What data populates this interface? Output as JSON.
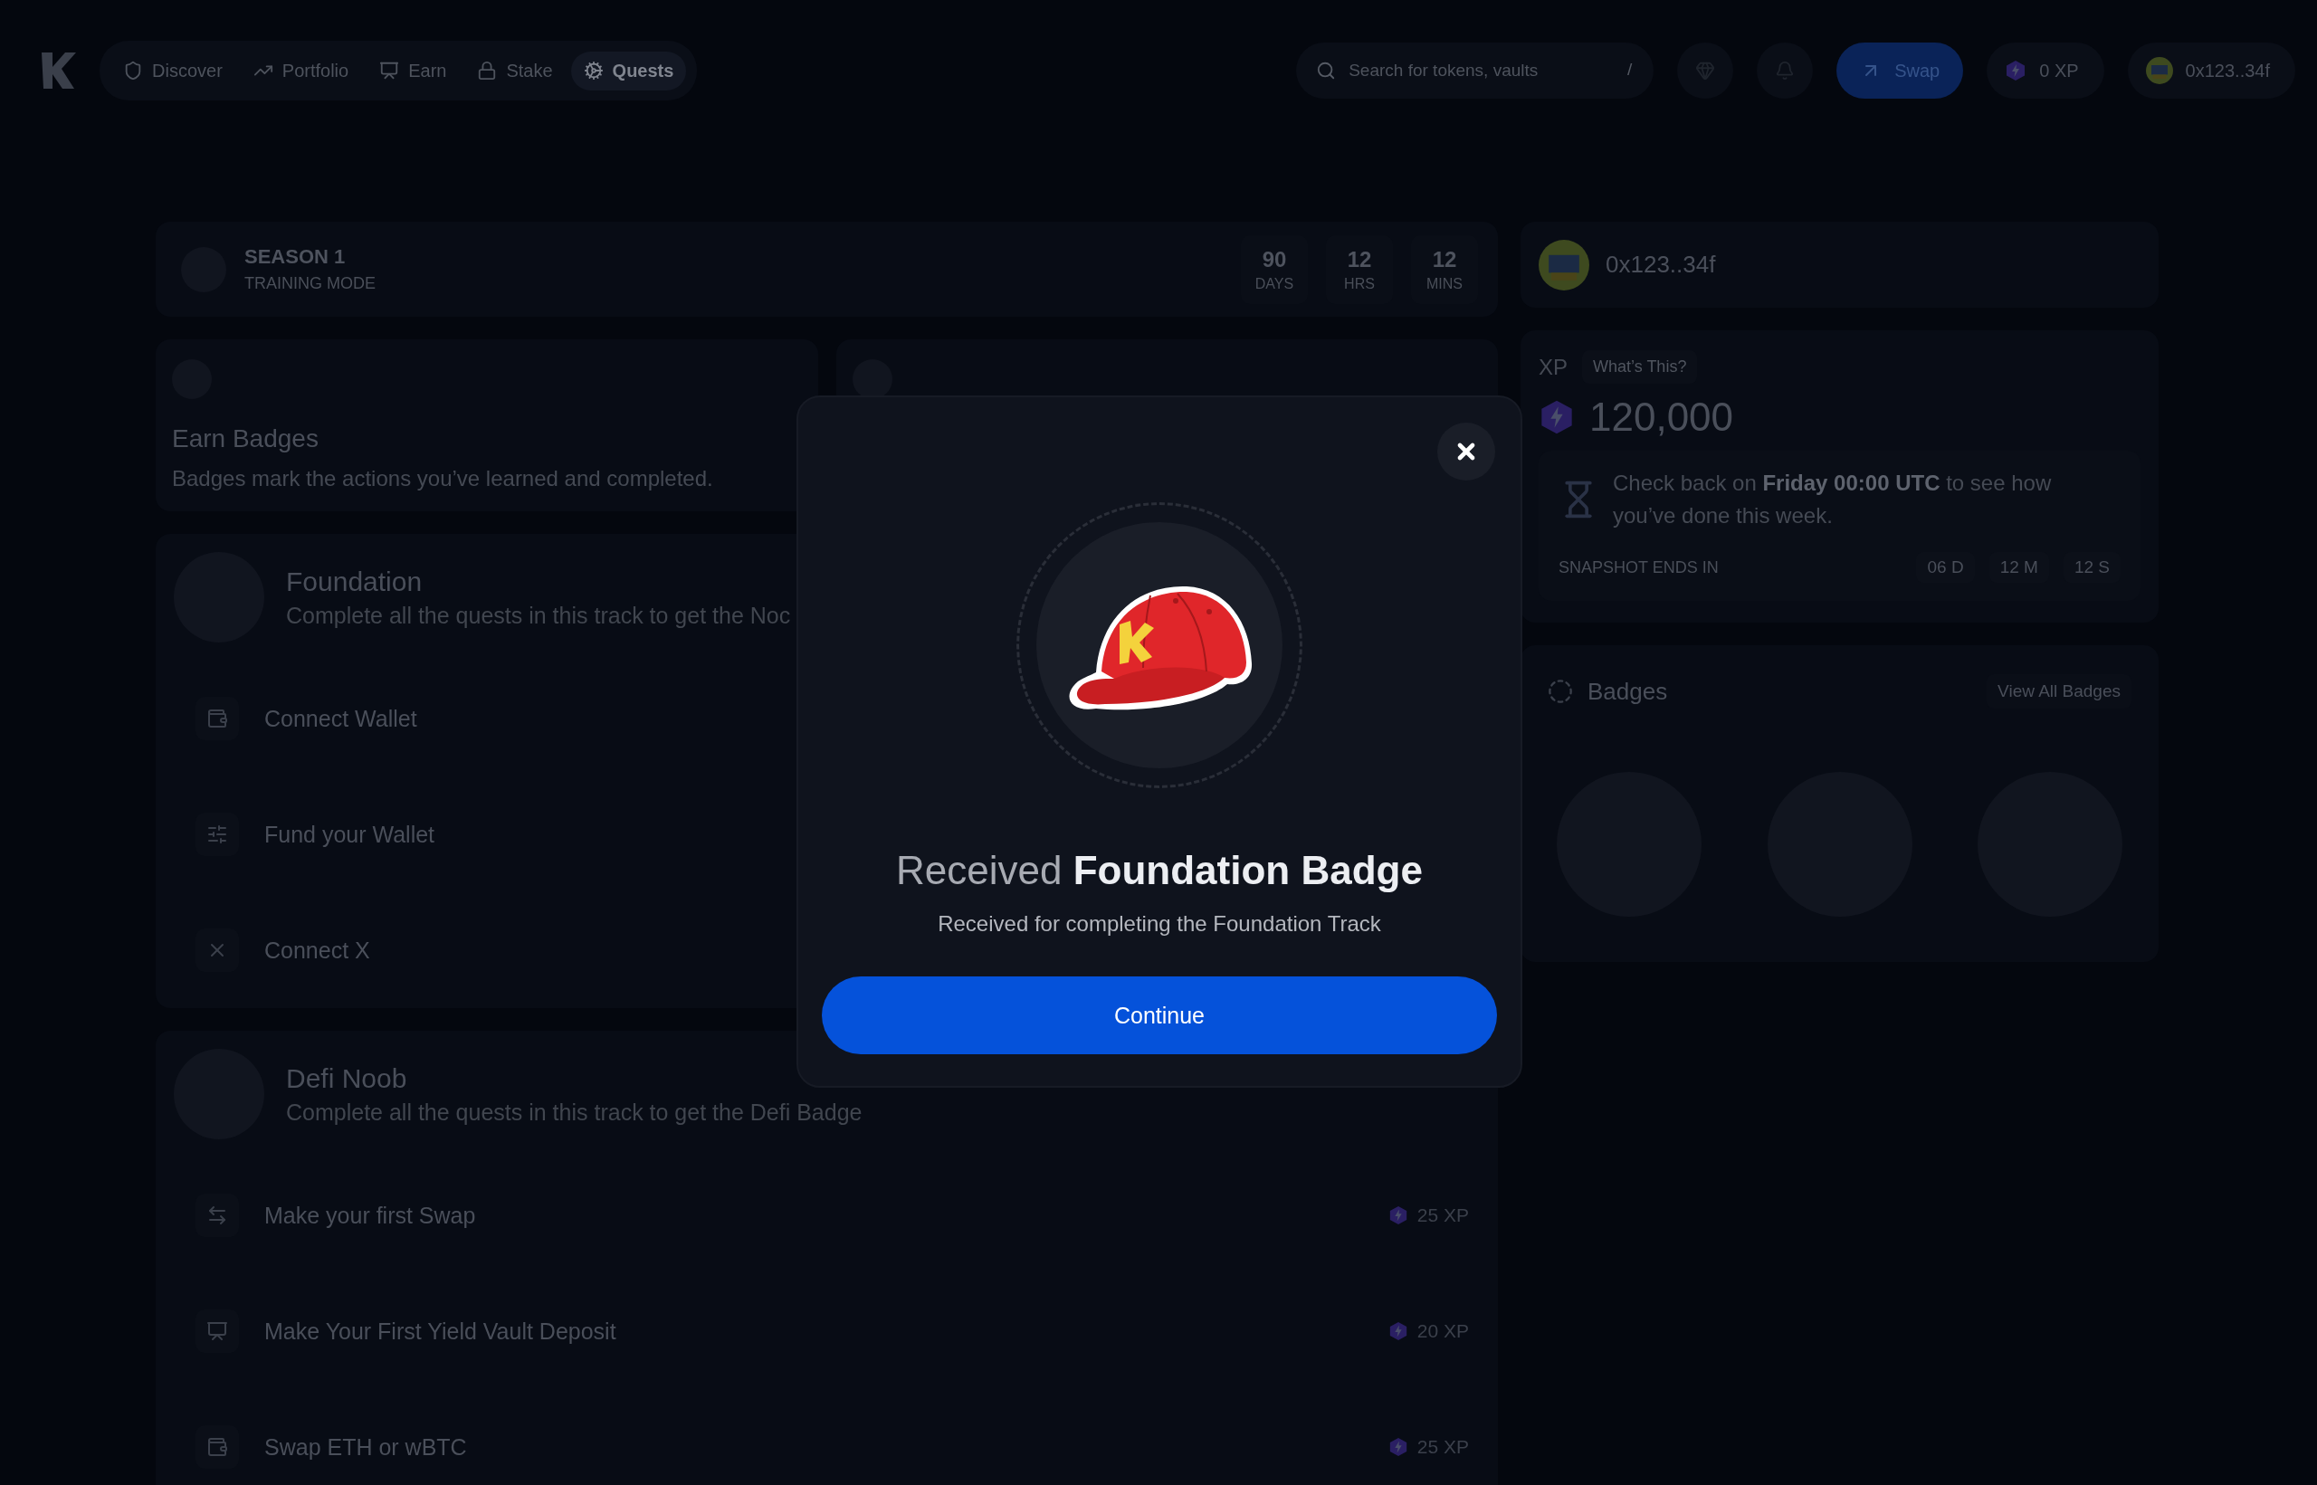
{
  "nav": {
    "items": [
      {
        "label": "Discover",
        "selected": false
      },
      {
        "label": "Portfolio",
        "selected": false
      },
      {
        "label": "Earn",
        "selected": false
      },
      {
        "label": "Stake",
        "selected": false
      },
      {
        "label": "Quests",
        "selected": true
      }
    ]
  },
  "search": {
    "placeholder": "Search for tokens, vaults",
    "shortcut": "/"
  },
  "swap_button": "Swap",
  "xp_button": "0 XP",
  "account_button": "0x123..34f",
  "season": {
    "title": "SEASON 1",
    "subtitle": "TRAINING MODE",
    "countdown": [
      {
        "value": "90",
        "unit": "DAYS"
      },
      {
        "value": "12",
        "unit": "HRS"
      },
      {
        "value": "12",
        "unit": "MINS"
      }
    ]
  },
  "earn_badges": {
    "title": "Earn Badges",
    "description": "Badges mark the actions you’ve learned and completed."
  },
  "tracks": [
    {
      "title": "Foundation",
      "description": "Complete all the quests in this track to get the Noc",
      "quests": [
        {
          "label": "Connect Wallet"
        },
        {
          "label": "Fund your Wallet"
        },
        {
          "label": "Connect X"
        }
      ]
    },
    {
      "title": "Defi Noob",
      "description": "Complete all the quests in this track to get the Defi Badge",
      "quests": [
        {
          "label": "Make your first Swap",
          "xp": "25 XP"
        },
        {
          "label": "Make Your First Yield Vault Deposit",
          "xp": "20 XP"
        },
        {
          "label": "Swap ETH or wBTC",
          "xp": "25 XP"
        }
      ]
    }
  ],
  "profile": {
    "address": "0x123..34f"
  },
  "xp_card": {
    "label": "XP",
    "help": "What’s This?",
    "total": "120,000",
    "notice": "Check back on **Friday 00:00 UTC** to see how you’ve done this week.",
    "snapshot_label": "SNAPSHOT ENDS IN",
    "snapshot": [
      {
        "value": "06",
        "unit": "D"
      },
      {
        "value": "12",
        "unit": "M"
      },
      {
        "value": "12",
        "unit": "S"
      }
    ]
  },
  "badges_card": {
    "title": "Badges",
    "link": "View All Badges"
  },
  "modal": {
    "title_lead": "Received",
    "title_main": "Foundation Badge",
    "subtitle": "Received for completing the Foundation Track",
    "button": "Continue"
  }
}
